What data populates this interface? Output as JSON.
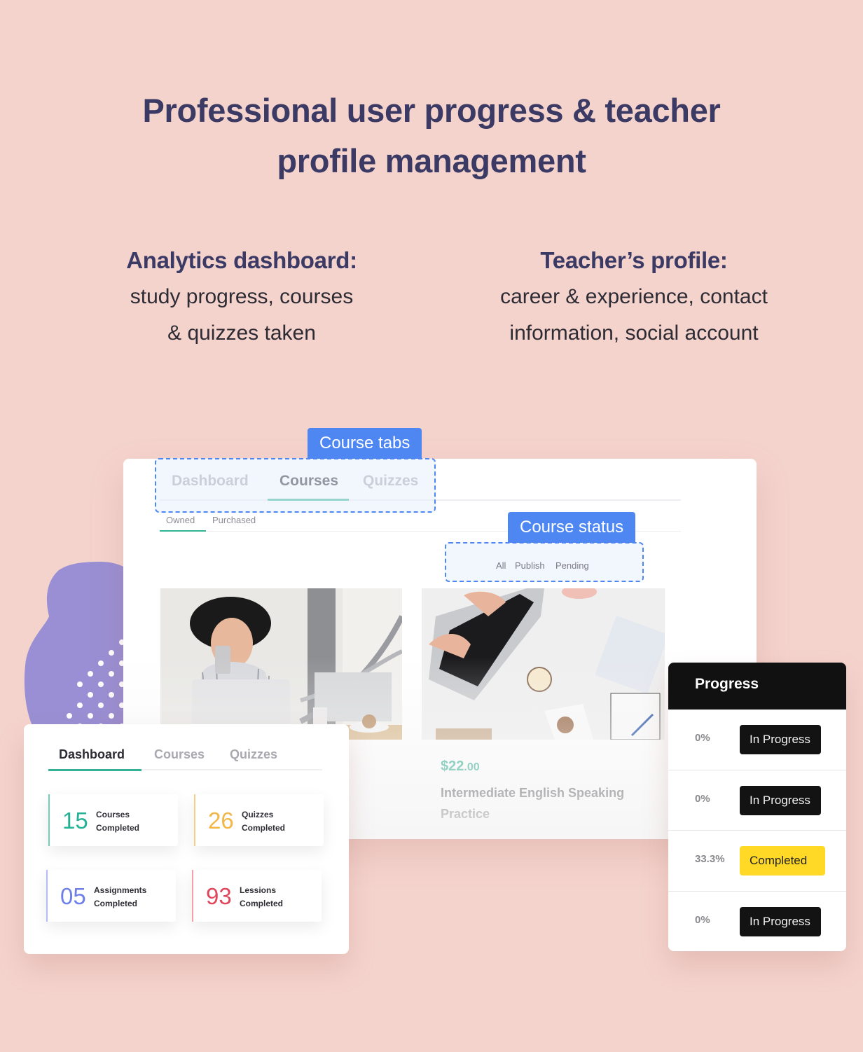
{
  "header": {
    "title_line1": "Professional user progress & teacher",
    "title_line2": "profile management"
  },
  "features": [
    {
      "title": "Analytics dashboard:",
      "desc_line1": "study progress, courses",
      "desc_line2": "& quizzes taken"
    },
    {
      "title": "Teacher’s profile:",
      "desc_line1": "career & experience, contact",
      "desc_line2": "information, social account"
    }
  ],
  "callouts": {
    "course_tabs": "Course tabs",
    "course_status": "Course status"
  },
  "courses_panel": {
    "tabs": [
      {
        "label": "Dashboard",
        "active": false
      },
      {
        "label": "Courses",
        "active": true
      },
      {
        "label": "Quizzes",
        "active": false
      }
    ],
    "subtabs": [
      {
        "label": "Owned",
        "active": true
      },
      {
        "label": "Purchased",
        "active": false
      }
    ],
    "status_filters": [
      "All",
      "Publish",
      "Pending"
    ],
    "course_cards": [
      {
        "image": "woman-with-phone-and-laptop-photo"
      },
      {
        "image": "laptop-desk-flatlay-photo",
        "price_main": "$22",
        "price_cents": ".00",
        "title": "Intermediate English Speaking Practice"
      }
    ]
  },
  "dashboard_panel": {
    "tabs": [
      {
        "label": "Dashboard",
        "active": true
      },
      {
        "label": "Courses",
        "active": false
      },
      {
        "label": "Quizzes",
        "active": false
      }
    ],
    "stats": [
      {
        "value": "15",
        "label_line1": "Courses",
        "label_line2": "Completed",
        "color": "#26b196"
      },
      {
        "value": "26",
        "label_line1": "Quizzes",
        "label_line2": "Completed",
        "color": "#f2b746"
      },
      {
        "value": "05",
        "label_line1": "Assignments",
        "label_line2": "Completed",
        "color": "#6f7fe8"
      },
      {
        "value": "93",
        "label_line1": "Lessions",
        "label_line2": "Completed",
        "color": "#e0465b"
      }
    ]
  },
  "progress_panel": {
    "title": "Progress",
    "rows": [
      {
        "percent": "0%",
        "status": "In Progress"
      },
      {
        "percent": "0%",
        "status": "In Progress"
      },
      {
        "percent": "33.3%",
        "status": "Completed"
      },
      {
        "percent": "0%",
        "status": "In Progress"
      }
    ]
  },
  "colors": {
    "background": "#f5d3cd",
    "heading": "#3a3a64",
    "accent_blue": "#4e86f2",
    "accent_green": "#33b395",
    "badge_dark": "#131313",
    "badge_yellow": "#ffd926",
    "blob": "#9a8fd4"
  }
}
